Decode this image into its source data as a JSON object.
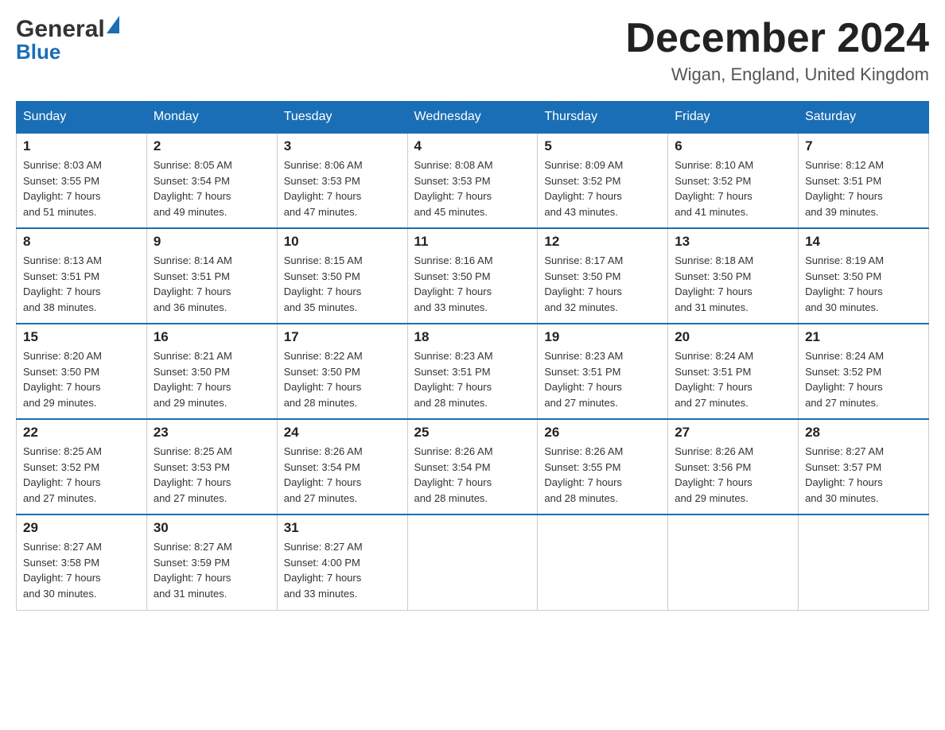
{
  "logo": {
    "general": "General",
    "blue": "Blue"
  },
  "title": {
    "month_year": "December 2024",
    "location": "Wigan, England, United Kingdom"
  },
  "days_of_week": [
    "Sunday",
    "Monday",
    "Tuesday",
    "Wednesday",
    "Thursday",
    "Friday",
    "Saturday"
  ],
  "weeks": [
    [
      {
        "day": "1",
        "sunrise": "8:03 AM",
        "sunset": "3:55 PM",
        "daylight": "7 hours and 51 minutes."
      },
      {
        "day": "2",
        "sunrise": "8:05 AM",
        "sunset": "3:54 PM",
        "daylight": "7 hours and 49 minutes."
      },
      {
        "day": "3",
        "sunrise": "8:06 AM",
        "sunset": "3:53 PM",
        "daylight": "7 hours and 47 minutes."
      },
      {
        "day": "4",
        "sunrise": "8:08 AM",
        "sunset": "3:53 PM",
        "daylight": "7 hours and 45 minutes."
      },
      {
        "day": "5",
        "sunrise": "8:09 AM",
        "sunset": "3:52 PM",
        "daylight": "7 hours and 43 minutes."
      },
      {
        "day": "6",
        "sunrise": "8:10 AM",
        "sunset": "3:52 PM",
        "daylight": "7 hours and 41 minutes."
      },
      {
        "day": "7",
        "sunrise": "8:12 AM",
        "sunset": "3:51 PM",
        "daylight": "7 hours and 39 minutes."
      }
    ],
    [
      {
        "day": "8",
        "sunrise": "8:13 AM",
        "sunset": "3:51 PM",
        "daylight": "7 hours and 38 minutes."
      },
      {
        "day": "9",
        "sunrise": "8:14 AM",
        "sunset": "3:51 PM",
        "daylight": "7 hours and 36 minutes."
      },
      {
        "day": "10",
        "sunrise": "8:15 AM",
        "sunset": "3:50 PM",
        "daylight": "7 hours and 35 minutes."
      },
      {
        "day": "11",
        "sunrise": "8:16 AM",
        "sunset": "3:50 PM",
        "daylight": "7 hours and 33 minutes."
      },
      {
        "day": "12",
        "sunrise": "8:17 AM",
        "sunset": "3:50 PM",
        "daylight": "7 hours and 32 minutes."
      },
      {
        "day": "13",
        "sunrise": "8:18 AM",
        "sunset": "3:50 PM",
        "daylight": "7 hours and 31 minutes."
      },
      {
        "day": "14",
        "sunrise": "8:19 AM",
        "sunset": "3:50 PM",
        "daylight": "7 hours and 30 minutes."
      }
    ],
    [
      {
        "day": "15",
        "sunrise": "8:20 AM",
        "sunset": "3:50 PM",
        "daylight": "7 hours and 29 minutes."
      },
      {
        "day": "16",
        "sunrise": "8:21 AM",
        "sunset": "3:50 PM",
        "daylight": "7 hours and 29 minutes."
      },
      {
        "day": "17",
        "sunrise": "8:22 AM",
        "sunset": "3:50 PM",
        "daylight": "7 hours and 28 minutes."
      },
      {
        "day": "18",
        "sunrise": "8:23 AM",
        "sunset": "3:51 PM",
        "daylight": "7 hours and 28 minutes."
      },
      {
        "day": "19",
        "sunrise": "8:23 AM",
        "sunset": "3:51 PM",
        "daylight": "7 hours and 27 minutes."
      },
      {
        "day": "20",
        "sunrise": "8:24 AM",
        "sunset": "3:51 PM",
        "daylight": "7 hours and 27 minutes."
      },
      {
        "day": "21",
        "sunrise": "8:24 AM",
        "sunset": "3:52 PM",
        "daylight": "7 hours and 27 minutes."
      }
    ],
    [
      {
        "day": "22",
        "sunrise": "8:25 AM",
        "sunset": "3:52 PM",
        "daylight": "7 hours and 27 minutes."
      },
      {
        "day": "23",
        "sunrise": "8:25 AM",
        "sunset": "3:53 PM",
        "daylight": "7 hours and 27 minutes."
      },
      {
        "day": "24",
        "sunrise": "8:26 AM",
        "sunset": "3:54 PM",
        "daylight": "7 hours and 27 minutes."
      },
      {
        "day": "25",
        "sunrise": "8:26 AM",
        "sunset": "3:54 PM",
        "daylight": "7 hours and 28 minutes."
      },
      {
        "day": "26",
        "sunrise": "8:26 AM",
        "sunset": "3:55 PM",
        "daylight": "7 hours and 28 minutes."
      },
      {
        "day": "27",
        "sunrise": "8:26 AM",
        "sunset": "3:56 PM",
        "daylight": "7 hours and 29 minutes."
      },
      {
        "day": "28",
        "sunrise": "8:27 AM",
        "sunset": "3:57 PM",
        "daylight": "7 hours and 30 minutes."
      }
    ],
    [
      {
        "day": "29",
        "sunrise": "8:27 AM",
        "sunset": "3:58 PM",
        "daylight": "7 hours and 30 minutes."
      },
      {
        "day": "30",
        "sunrise": "8:27 AM",
        "sunset": "3:59 PM",
        "daylight": "7 hours and 31 minutes."
      },
      {
        "day": "31",
        "sunrise": "8:27 AM",
        "sunset": "4:00 PM",
        "daylight": "7 hours and 33 minutes."
      },
      null,
      null,
      null,
      null
    ]
  ],
  "labels": {
    "sunrise": "Sunrise:",
    "sunset": "Sunset:",
    "daylight": "Daylight:"
  }
}
